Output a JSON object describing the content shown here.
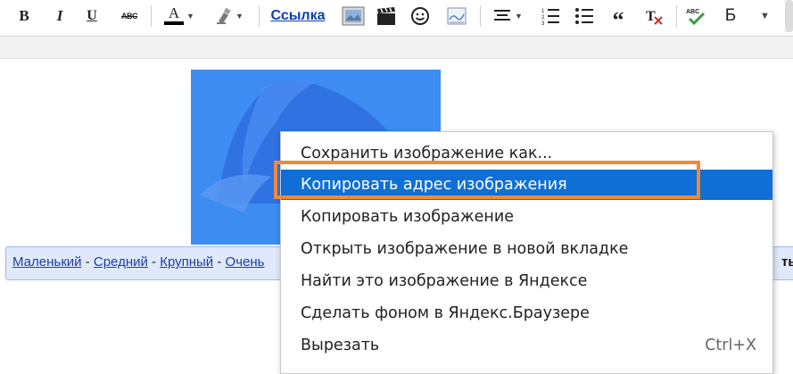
{
  "toolbar": {
    "bold_label": "B",
    "italic_label": "I",
    "underline_label": "U",
    "strike_label": "ABC",
    "font_color_label": "A",
    "link_label": "Ссылка",
    "quote_label": "“",
    "cyr_b_label": "Б",
    "accent_color": "#0b3fae"
  },
  "image_size_bar": {
    "links": [
      "Маленький",
      "Средний",
      "Крупный",
      "Очень"
    ],
    "separator": "-",
    "right_text": "ть п"
  },
  "context_menu": {
    "items": [
      {
        "label": "Сохранить изображение как...",
        "shortcut": "",
        "highlighted": false
      },
      {
        "label": "Копировать адрес изображения",
        "shortcut": "",
        "highlighted": true
      },
      {
        "label": "Копировать изображение",
        "shortcut": "",
        "highlighted": false
      },
      {
        "label": "Открыть изображение в новой вкладке",
        "shortcut": "",
        "highlighted": false
      },
      {
        "label": "Найти это изображение в Яндексе",
        "shortcut": "",
        "highlighted": false
      },
      {
        "label": "Сделать фоном в Яндекс.Браузере",
        "shortcut": "",
        "highlighted": false
      },
      {
        "label": "Вырезать",
        "shortcut": "Ctrl+X",
        "highlighted": false
      }
    ],
    "highlight_color": "#0f6fd6",
    "annotation_color": "#f18a35"
  }
}
